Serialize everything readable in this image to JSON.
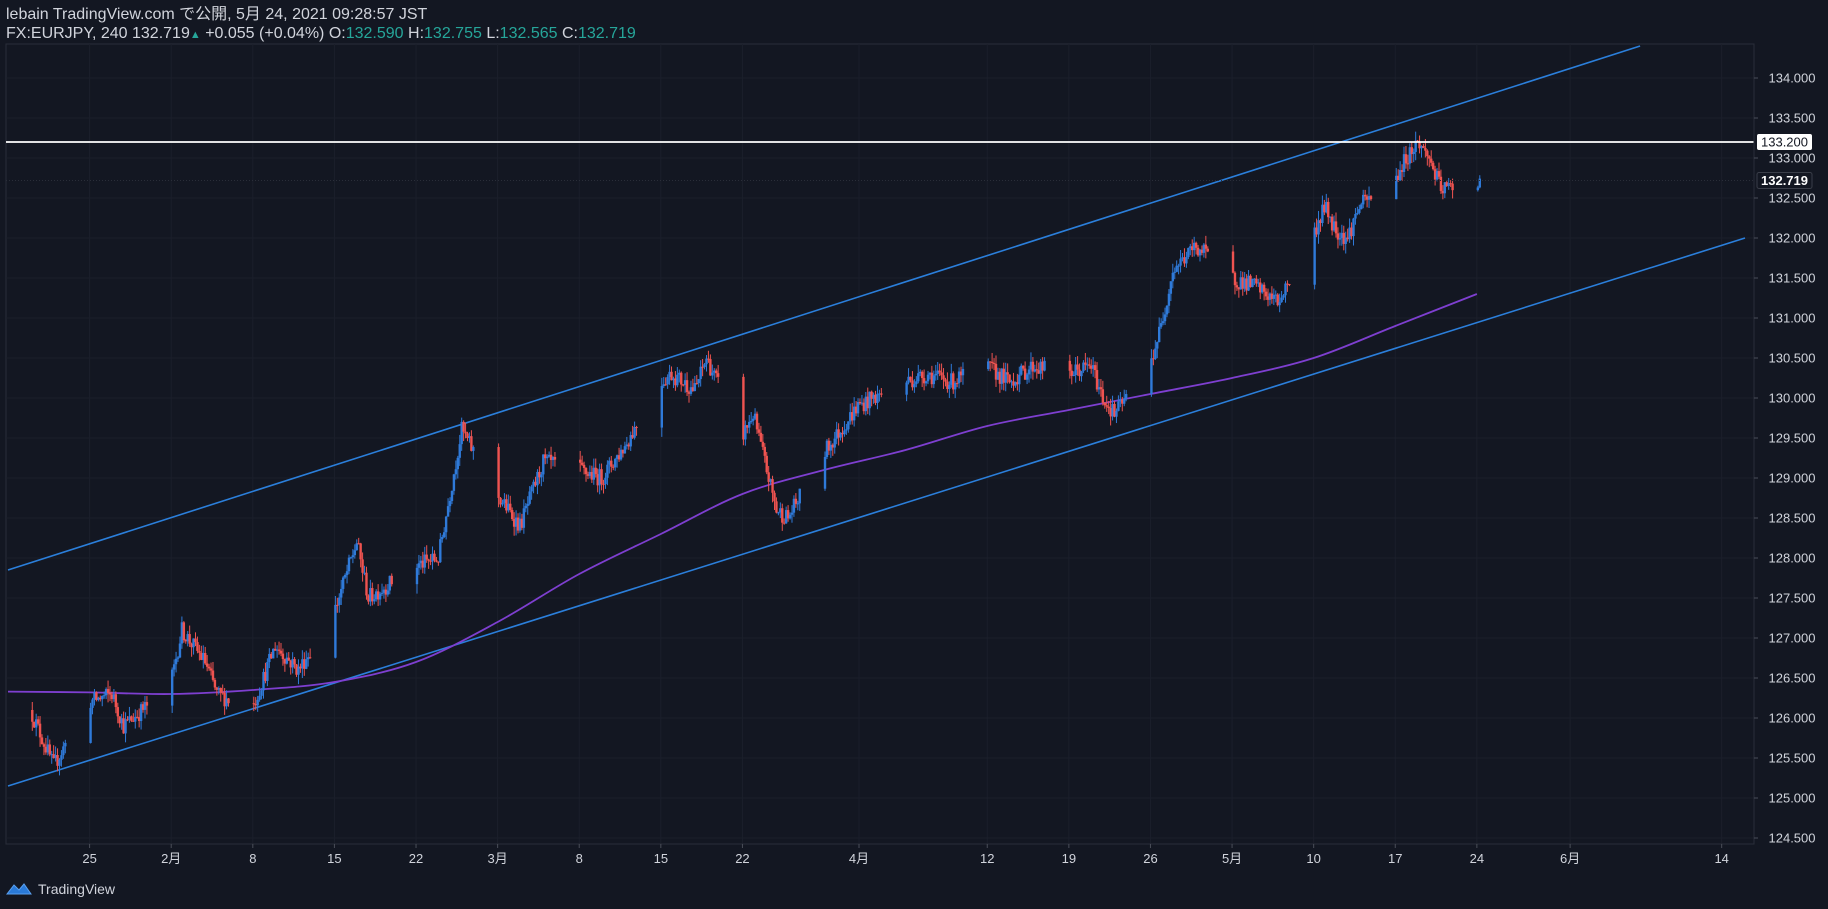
{
  "header": {
    "line1": "lebain TradingView.com で公開, 5月 24, 2021 09:28:57 JST",
    "symbol_interval": "FX:EURJPY, 240",
    "last": "132.719",
    "up_arrow": "▲",
    "change": "+0.055 (+0.04%)",
    "o_label": "O:",
    "o_value": "132.590",
    "h_label": "H:",
    "h_value": "132.755",
    "l_label": "L:",
    "l_value": "132.565",
    "c_label": "C:",
    "c_value": "132.719"
  },
  "footer": {
    "brand": "TradingView",
    "logo_icon": "tradingview-logo-icon"
  },
  "colors": {
    "background": "#131722",
    "up": "#2f7ad9",
    "down": "#ef5350",
    "channel": "#2b7fdb",
    "ma": "#7e3fd0",
    "hline": "#ffffff",
    "grid_axis": "#2a2e39",
    "text": "#d1d4dc"
  },
  "chart_data": {
    "type": "candlestick",
    "symbol": "FX:EURJPY",
    "interval": "240",
    "ylim": [
      124.5,
      134.4
    ],
    "y_ticks": [
      "124.500",
      "125.000",
      "125.500",
      "126.000",
      "126.500",
      "127.000",
      "127.500",
      "128.000",
      "128.500",
      "129.000",
      "129.500",
      "130.000",
      "130.500",
      "131.000",
      "131.500",
      "132.000",
      "132.500",
      "133.000",
      "133.500",
      "134.000"
    ],
    "x_tick_labels": [
      {
        "label": "25",
        "date": "2021-01-25"
      },
      {
        "label": "2月",
        "date": "2021-02-01"
      },
      {
        "label": "8",
        "date": "2021-02-08"
      },
      {
        "label": "15",
        "date": "2021-02-15"
      },
      {
        "label": "22",
        "date": "2021-02-22"
      },
      {
        "label": "3月",
        "date": "2021-03-01"
      },
      {
        "label": "8",
        "date": "2021-03-08"
      },
      {
        "label": "15",
        "date": "2021-03-15"
      },
      {
        "label": "22",
        "date": "2021-03-22"
      },
      {
        "label": "4月",
        "date": "2021-04-01"
      },
      {
        "label": "12",
        "date": "2021-04-12"
      },
      {
        "label": "19",
        "date": "2021-04-19"
      },
      {
        "label": "26",
        "date": "2021-04-26"
      },
      {
        "label": "5月",
        "date": "2021-05-03"
      },
      {
        "label": "10",
        "date": "2021-05-10"
      },
      {
        "label": "17",
        "date": "2021-05-17"
      },
      {
        "label": "24",
        "date": "2021-05-24"
      },
      {
        "label": "6月",
        "date": "2021-06-01"
      },
      {
        "label": "14",
        "date": "2021-06-14"
      }
    ],
    "price_path": [
      {
        "date": "2021-01-20",
        "value": 126.1
      },
      {
        "date": "2021-01-22",
        "value": 125.4
      },
      {
        "date": "2021-01-25",
        "value": 126.2
      },
      {
        "date": "2021-01-27",
        "value": 126.3
      },
      {
        "date": "2021-01-28",
        "value": 125.9
      },
      {
        "date": "2021-02-01",
        "value": 126.4
      },
      {
        "date": "2021-02-02",
        "value": 127.1
      },
      {
        "date": "2021-02-04",
        "value": 126.7
      },
      {
        "date": "2021-02-05",
        "value": 126.3
      },
      {
        "date": "2021-02-08",
        "value": 126.1
      },
      {
        "date": "2021-02-10",
        "value": 126.9
      },
      {
        "date": "2021-02-12",
        "value": 126.6
      },
      {
        "date": "2021-02-15",
        "value": 127.3
      },
      {
        "date": "2021-02-17",
        "value": 128.2
      },
      {
        "date": "2021-02-18",
        "value": 127.5
      },
      {
        "date": "2021-02-22",
        "value": 127.9
      },
      {
        "date": "2021-02-24",
        "value": 128.0
      },
      {
        "date": "2021-02-26",
        "value": 129.6
      },
      {
        "date": "2021-03-01",
        "value": 128.8
      },
      {
        "date": "2021-03-03",
        "value": 128.4
      },
      {
        "date": "2021-03-05",
        "value": 129.2
      },
      {
        "date": "2021-03-08",
        "value": 129.1
      },
      {
        "date": "2021-03-10",
        "value": 129.0
      },
      {
        "date": "2021-03-12",
        "value": 129.4
      },
      {
        "date": "2021-03-15",
        "value": 130.2
      },
      {
        "date": "2021-03-16",
        "value": 130.3
      },
      {
        "date": "2021-03-18",
        "value": 130.1
      },
      {
        "date": "2021-03-19",
        "value": 130.5
      },
      {
        "date": "2021-03-22",
        "value": 129.5
      },
      {
        "date": "2021-03-23",
        "value": 129.8
      },
      {
        "date": "2021-03-25",
        "value": 128.6
      },
      {
        "date": "2021-03-26",
        "value": 128.5
      },
      {
        "date": "2021-03-29",
        "value": 129.3
      },
      {
        "date": "2021-04-01",
        "value": 129.9
      },
      {
        "date": "2021-04-05",
        "value": 130.2
      },
      {
        "date": "2021-04-07",
        "value": 130.3
      },
      {
        "date": "2021-04-09",
        "value": 130.2
      },
      {
        "date": "2021-04-12",
        "value": 130.4
      },
      {
        "date": "2021-04-14",
        "value": 130.2
      },
      {
        "date": "2021-04-16",
        "value": 130.4
      },
      {
        "date": "2021-04-19",
        "value": 130.3
      },
      {
        "date": "2021-04-21",
        "value": 130.4
      },
      {
        "date": "2021-04-22",
        "value": 130.0
      },
      {
        "date": "2021-04-23",
        "value": 129.8
      },
      {
        "date": "2021-04-26",
        "value": 130.4
      },
      {
        "date": "2021-04-27",
        "value": 130.9
      },
      {
        "date": "2021-04-28",
        "value": 131.6
      },
      {
        "date": "2021-04-30",
        "value": 131.9
      },
      {
        "date": "2021-05-03",
        "value": 131.5
      },
      {
        "date": "2021-05-05",
        "value": 131.4
      },
      {
        "date": "2021-05-07",
        "value": 131.2
      },
      {
        "date": "2021-05-10",
        "value": 132.0
      },
      {
        "date": "2021-05-11",
        "value": 132.4
      },
      {
        "date": "2021-05-12",
        "value": 132.1
      },
      {
        "date": "2021-05-13",
        "value": 132.0
      },
      {
        "date": "2021-05-14",
        "value": 132.4
      },
      {
        "date": "2021-05-17",
        "value": 132.7
      },
      {
        "date": "2021-05-18",
        "value": 133.0
      },
      {
        "date": "2021-05-19",
        "value": 133.2
      },
      {
        "date": "2021-05-20",
        "value": 133.0
      },
      {
        "date": "2021-05-21",
        "value": 132.6
      },
      {
        "date": "2021-05-24",
        "value": 132.719
      }
    ],
    "moving_average": [
      {
        "date": "2021-01-18",
        "value": 126.33
      },
      {
        "date": "2021-01-25",
        "value": 126.32
      },
      {
        "date": "2021-02-01",
        "value": 126.3
      },
      {
        "date": "2021-02-08",
        "value": 126.35
      },
      {
        "date": "2021-02-15",
        "value": 126.45
      },
      {
        "date": "2021-02-22",
        "value": 126.7
      },
      {
        "date": "2021-03-01",
        "value": 127.2
      },
      {
        "date": "2021-03-08",
        "value": 127.8
      },
      {
        "date": "2021-03-15",
        "value": 128.3
      },
      {
        "date": "2021-03-22",
        "value": 128.8
      },
      {
        "date": "2021-03-29",
        "value": 129.1
      },
      {
        "date": "2021-04-05",
        "value": 129.35
      },
      {
        "date": "2021-04-12",
        "value": 129.65
      },
      {
        "date": "2021-04-19",
        "value": 129.85
      },
      {
        "date": "2021-04-26",
        "value": 130.05
      },
      {
        "date": "2021-05-03",
        "value": 130.25
      },
      {
        "date": "2021-05-10",
        "value": 130.5
      },
      {
        "date": "2021-05-17",
        "value": 130.9
      },
      {
        "date": "2021-05-24",
        "value": 131.3
      }
    ],
    "channel_upper": [
      {
        "date": "2021-01-18",
        "value": 127.85
      },
      {
        "date": "2021-06-07",
        "value": 134.4
      }
    ],
    "channel_lower": [
      {
        "date": "2021-01-18",
        "value": 125.15
      },
      {
        "date": "2021-06-16",
        "value": 132.0
      }
    ],
    "horizontal_line": {
      "value": 133.2,
      "label": "133.200"
    },
    "last_price": {
      "value": 132.719,
      "label": "132.719"
    }
  }
}
